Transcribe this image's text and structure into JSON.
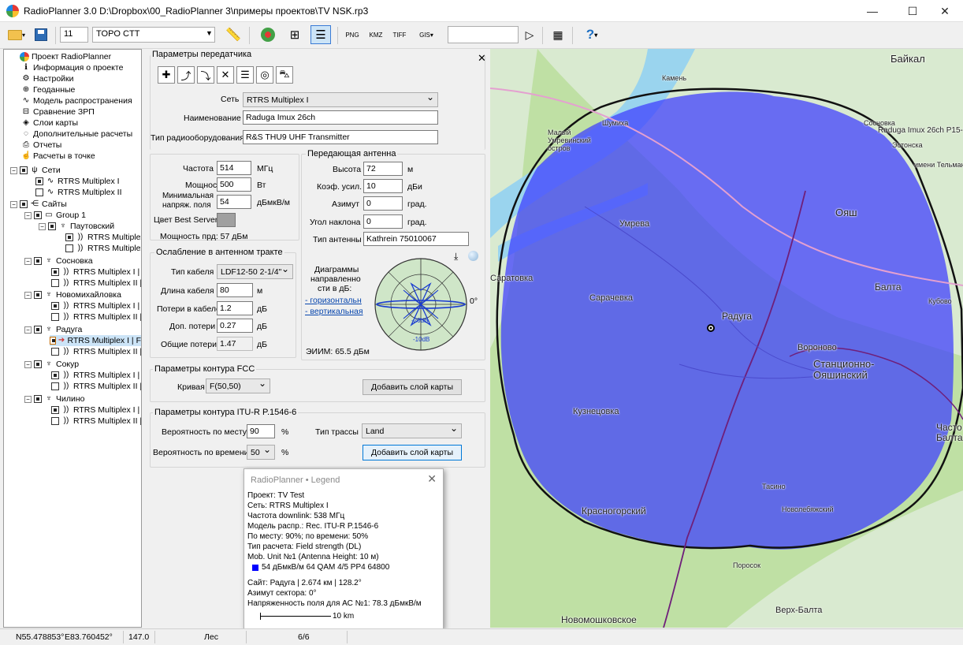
{
  "window": {
    "title": "RadioPlanner 3.0 D:\\Dropbox\\00_RadioPlanner 3\\примеры проектов\\TV NSK.rp3",
    "minimize": "—",
    "maximize": "☐",
    "close": "✕"
  },
  "toolbar": {
    "zoom_value": "11",
    "map_layer": "TOPO CTT",
    "search_value": "",
    "help": "?"
  },
  "tree": {
    "root": [
      "Проект RadioPlanner",
      "Информация о проекте",
      "Настройки",
      "Геоданные",
      "Модель распространения",
      "Сравнение ЗРП",
      "Слои карты",
      "Дополнительные расчеты",
      "Отчеты",
      "Расчеты в точке"
    ],
    "networks_label": "Сети",
    "networks": [
      "RTRS Multiplex I",
      "RTRS Multiplex II"
    ],
    "sites_label": "Сайты",
    "group": "Group 1",
    "sites": [
      {
        "name": "Паутовский",
        "items": [
          "RTRS Multiplex",
          "RTRS Multiplex"
        ]
      },
      {
        "name": "Сосновка",
        "items": [
          "RTRS Multiplex I | S",
          "RTRS Multiplex II | S"
        ]
      },
      {
        "name": "Новомихайловка",
        "items": [
          "RTRS Multiplex I | N",
          "RTRS Multiplex II | N"
        ]
      },
      {
        "name": "Радуга",
        "items": [
          "RTRS Multiplex I | F",
          "RTRS Multiplex II | F"
        ]
      },
      {
        "name": "Сокур",
        "items": [
          "RTRS Multiplex I | S",
          "RTRS Multiplex II | S"
        ]
      },
      {
        "name": "Чилино",
        "items": [
          "RTRS Multiplex I | C",
          "RTRS Multiplex II | C"
        ]
      }
    ]
  },
  "panel": {
    "title": "Параметры передатчика",
    "close": "✕",
    "network_label": "Сеть",
    "network": "RTRS Multiplex I",
    "name_label": "Наименование",
    "name": "Raduga Imux 26ch",
    "equip_label": "Тип радиооборудования",
    "equip": "R&S THU9 UHF Transmitter",
    "freq_label": "Частота",
    "freq": "514",
    "freq_unit": "МГц",
    "power_label": "Мощность",
    "power": "500",
    "power_unit": "Вт",
    "minfield_label1": "Минимальная",
    "minfield_label2": "напряж. поля",
    "minfield": "54",
    "minfield_unit": "дБмкВ/м",
    "bestserver_label": "Цвет Best Server",
    "powerprd": "Мощность прд: 57 дБм",
    "antenna_group": "Передающая антенна",
    "height_label": "Высота",
    "height": "72",
    "height_unit": "м",
    "gain_label": "Коэф. усил.",
    "gain": "10",
    "gain_unit": "дБи",
    "azimuth_label": "Азимут",
    "azimuth": "0",
    "azimuth_unit": "град.",
    "tilt_label": "Угол наклона",
    "tilt": "0",
    "tilt_unit": "град.",
    "anttype_label": "Тип антенны",
    "anttype": "Kathrein 75010067",
    "atten_group": "Ослабление в антенном тракте",
    "cable_label": "Тип кабеля",
    "cable": "LDF12-50   2-1/4\"",
    "cablelen_label": "Длина кабеля",
    "cablelen": "80",
    "cablelen_unit": "м",
    "cableloss_label": "Потери в кабеле",
    "cableloss": "1.2",
    "cableloss_unit": "дБ",
    "addloss_label": "Доп. потери",
    "addloss": "0.27",
    "addloss_unit": "дБ",
    "totloss_label": "Общие потери",
    "totloss": "1.47",
    "totloss_unit": "дБ",
    "diag_label1": "Диаграммы",
    "diag_label2": "направленно",
    "diag_label3": "сти в дБ:",
    "diag_h": "- горизонтальн",
    "diag_v": "- вертикальная",
    "diag_deg": "0°",
    "diag_20": "-20dB",
    "diag_10": "-10dB",
    "eirp": "ЭИИМ: 65.5 дБм",
    "fcc_group": "Параметры контура FCC",
    "curve_label": "Кривая",
    "curve": "F(50,50)",
    "add_layer": "Добавить слой карты",
    "itu_group": "Параметры контура ITU-R P.1546-6",
    "loc_prob_label": "Вероятность по месту",
    "loc_prob": "90",
    "pct": "%",
    "time_prob_label": "Вероятность по времени",
    "time_prob": "50",
    "path_label": "Тип трассы",
    "path": "Land"
  },
  "legend": {
    "title": "RadioPlanner • Legend",
    "close": "✕",
    "lines": [
      "Проект: TV Test",
      "Сеть: RTRS Multiplex I",
      "Частота downlink: 538 МГц",
      "Модель распр.: Rec. ITU-R P.1546-6",
      "По месту: 90%; по времени: 50%",
      "Тип расчета: Field strength (DL)",
      "Mob. Unit №1 (Antenna Height: 10 м)"
    ],
    "entry": "54 дБмкВ/м   64 QAM 4/5 PP4 64800",
    "entry_color": "#0000ff",
    "site_lines": [
      "Сайт: Радуга | 2.674 км | 128.2°",
      "Азимут сектора: 0°",
      "Напряженность поля для АС №1: 78.3 дБмкВ/м"
    ],
    "scale": "10 km"
  },
  "map": {
    "labels": [
      "Байкал",
      "Камень",
      "Шумиха",
      "Малый Умревинский остров",
      "Сосновка",
      "Raduga Imux 26ch P15-",
      "Эстонска",
      "имени Тельмана",
      "Ояш",
      "Умрева",
      "Саратовка",
      "Сарачевка",
      "Балта",
      "Радуга",
      "Вороново",
      "Станционно-Ояшинский",
      "Кубово",
      "Кузнецовка",
      "Красногорский",
      "Тасино",
      "Новолебяжский",
      "Верх-Балта",
      "Новомошковское",
      "Поросок",
      "Часто Балта"
    ],
    "coverage_color": "#3c3cff"
  },
  "status": {
    "coords1": "N55.478853°",
    "coords2": "E83.760452°",
    "elev": "147.0",
    "landcover": "Лес",
    "pages": "6/6"
  }
}
